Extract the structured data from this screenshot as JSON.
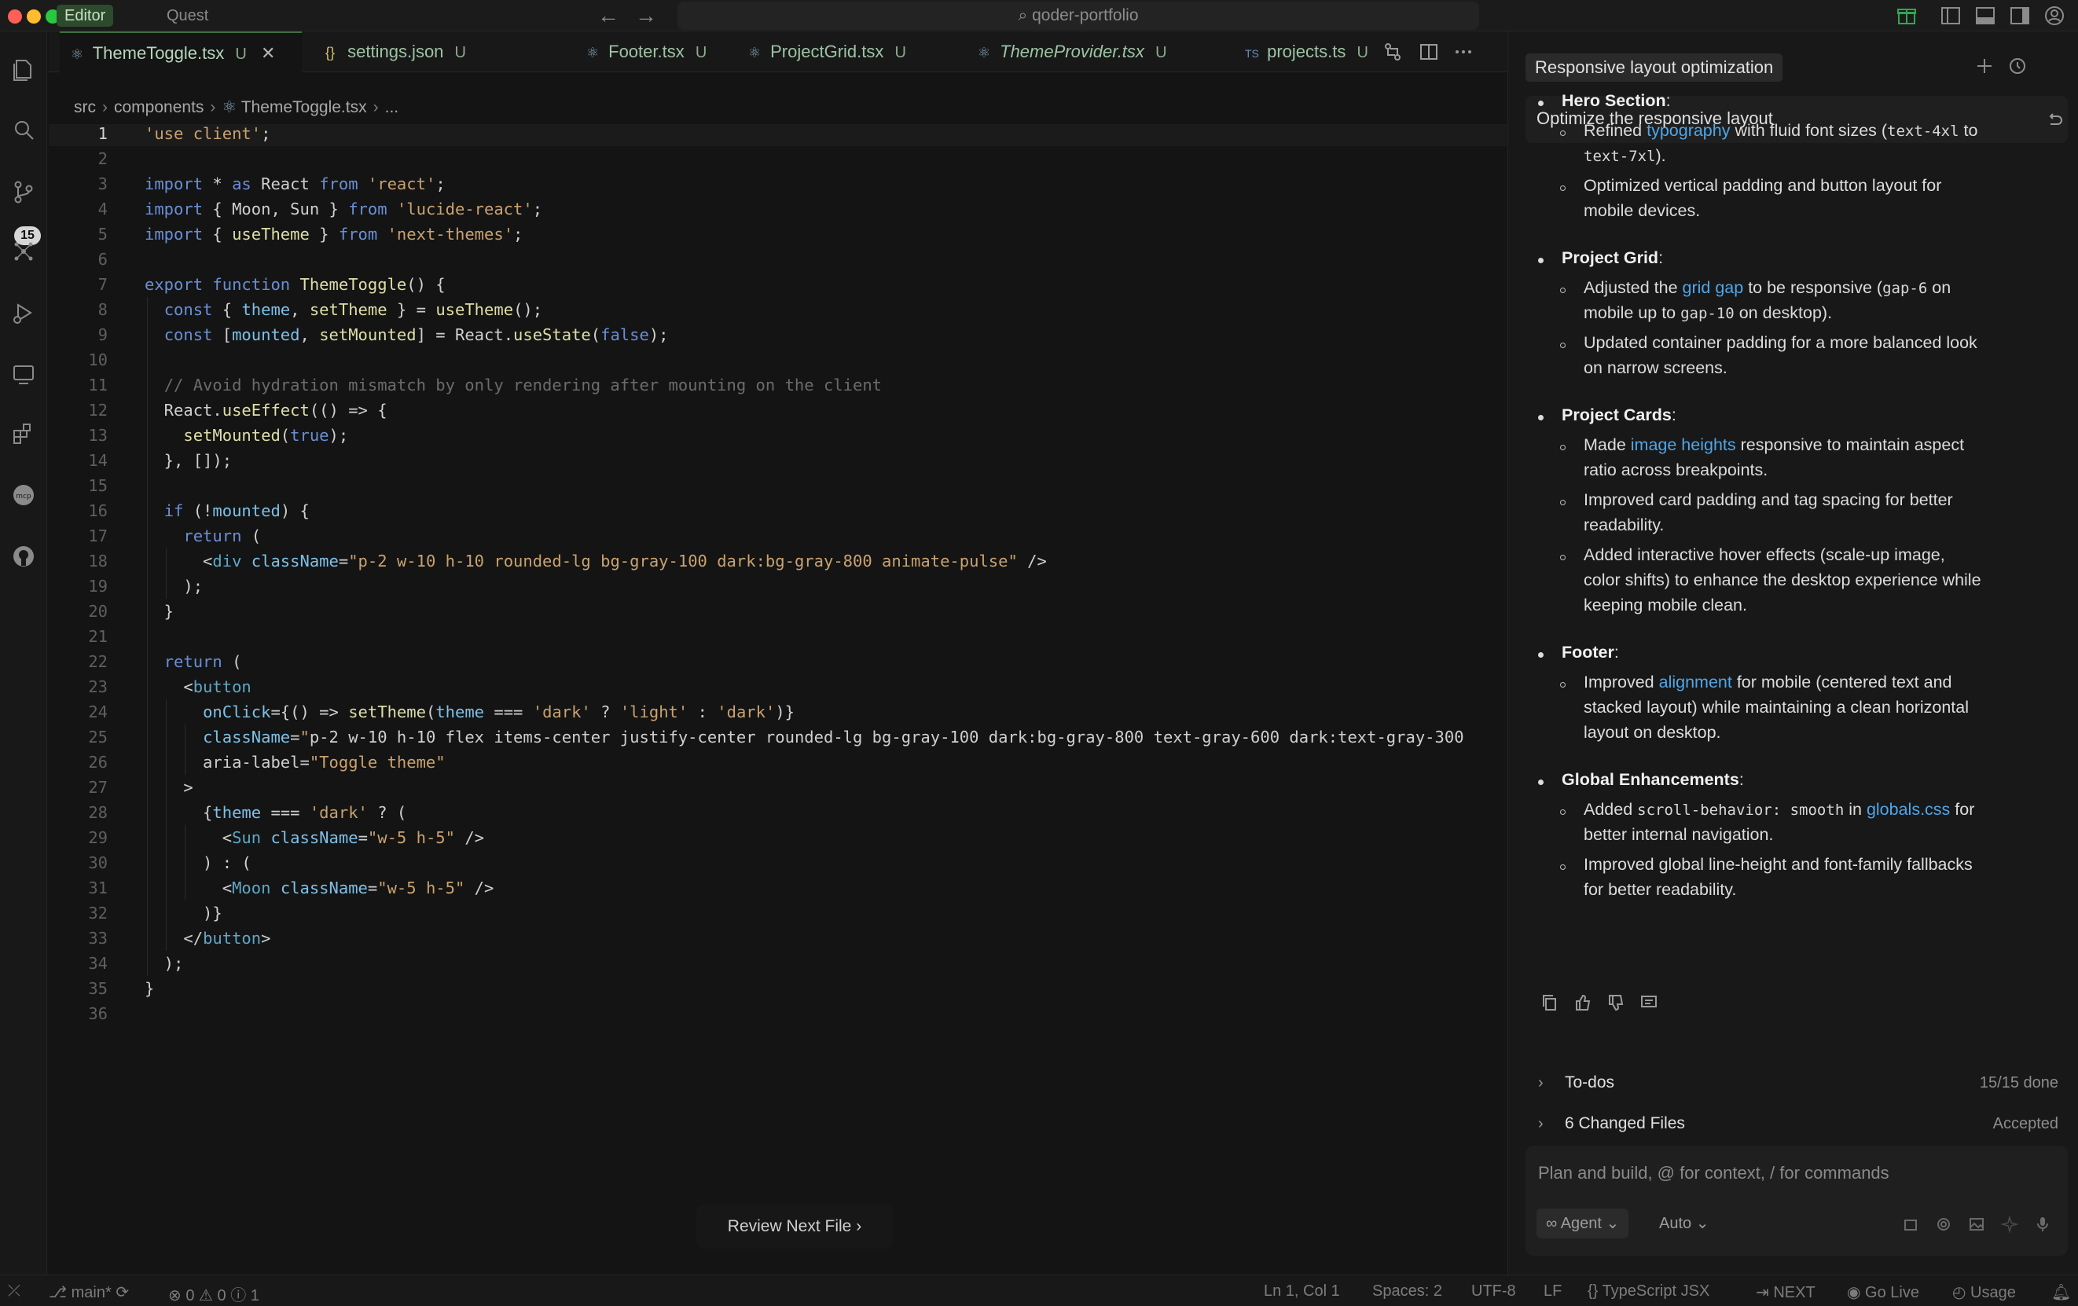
{
  "window": {
    "modes": [
      "Editor",
      "Quest"
    ],
    "search_text": "qoder-portfolio"
  },
  "activity": {
    "badge": "15"
  },
  "tabs": [
    {
      "label": "ThemeToggle.tsx",
      "status": "U",
      "icon": "react-icon",
      "active": true,
      "italic": false
    },
    {
      "label": "settings.json",
      "status": "U",
      "icon": "json-icon",
      "active": false,
      "italic": false
    },
    {
      "label": "Footer.tsx",
      "status": "U",
      "icon": "react-icon",
      "active": false,
      "italic": false
    },
    {
      "label": "ProjectGrid.tsx",
      "status": "U",
      "icon": "react-icon",
      "active": false,
      "italic": false
    },
    {
      "label": "ThemeProvider.tsx",
      "status": "U",
      "icon": "react-icon",
      "active": false,
      "italic": true
    },
    {
      "label": "projects.ts",
      "status": "U",
      "icon": "ts-icon",
      "active": false,
      "italic": false
    }
  ],
  "breadcrumb": [
    "src",
    "components",
    "ThemeToggle.tsx",
    "..."
  ],
  "editor": {
    "current_line": 1,
    "lines": [
      "'use client';",
      "",
      "import * as React from 'react';",
      "import { Moon, Sun } from 'lucide-react';",
      "import { useTheme } from 'next-themes';",
      "",
      "export function ThemeToggle() {",
      "  const { theme, setTheme } = useTheme();",
      "  const [mounted, setMounted] = React.useState(false);",
      "",
      "  // Avoid hydration mismatch by only rendering after mounting on the client",
      "  React.useEffect(() => {",
      "    setMounted(true);",
      "  }, []);",
      "",
      "  if (!mounted) {",
      "    return (",
      "      <div className=\"p-2 w-10 h-10 rounded-lg bg-gray-100 dark:bg-gray-800 animate-pulse\" />",
      "    );",
      "  }",
      "",
      "  return (",
      "    <button",
      "      onClick={() => setTheme(theme === 'dark' ? 'light' : 'dark')}",
      "      className=\"p-2 w-10 h-10 flex items-center justify-center rounded-lg bg-gray-100 dark:bg-gray-800 text-gray-600 dark:text-gray-300",
      "      aria-label=\"Toggle theme\"",
      "    >",
      "      {theme === 'dark' ? (",
      "        <Sun className=\"w-5 h-5\" />",
      "      ) : (",
      "        <Moon className=\"w-5 h-5\" />",
      "      )}",
      "    </button>",
      "  );",
      "}",
      ""
    ]
  },
  "review_button": "Review Next File",
  "panel": {
    "title": "Responsive layout optimization",
    "prompt": "Optimize the responsive layout",
    "sections": [
      {
        "heading": "Hero Section",
        "lines": [
          [
            [
              {
                "t": "Refined "
              },
              {
                "t": "typography",
                "c": "lk"
              },
              {
                "t": " with fluid font sizes ("
              },
              {
                "t": "text-4xl",
                "c": "mono"
              },
              {
                "t": " to"
              }
            ],
            [
              {
                "t": "text-7xl",
                "c": "mono"
              },
              {
                "t": ")."
              }
            ]
          ],
          [
            [
              {
                "t": "Optimized vertical padding and button layout for"
              }
            ],
            [
              {
                "t": "mobile devices."
              }
            ]
          ]
        ]
      },
      {
        "heading": "Project Grid",
        "lines": [
          [
            [
              {
                "t": "Adjusted the "
              },
              {
                "t": "grid gap",
                "c": "lk"
              },
              {
                "t": " to be responsive ("
              },
              {
                "t": "gap-6",
                "c": "mono"
              },
              {
                "t": " on"
              }
            ],
            [
              {
                "t": "mobile up to "
              },
              {
                "t": "gap-10",
                "c": "mono"
              },
              {
                "t": " on desktop)."
              }
            ]
          ],
          [
            [
              {
                "t": "Updated container padding for a more balanced look"
              }
            ],
            [
              {
                "t": "on narrow screens."
              }
            ]
          ]
        ]
      },
      {
        "heading": "Project Cards",
        "lines": [
          [
            [
              {
                "t": "Made "
              },
              {
                "t": "image heights",
                "c": "lk"
              },
              {
                "t": " responsive to maintain aspect"
              }
            ],
            [
              {
                "t": "ratio across breakpoints."
              }
            ]
          ],
          [
            [
              {
                "t": "Improved card padding and tag spacing for better"
              }
            ],
            [
              {
                "t": "readability."
              }
            ]
          ],
          [
            [
              {
                "t": "Added interactive hover effects (scale-up image,"
              }
            ],
            [
              {
                "t": "color shifts) to enhance the desktop experience while"
              }
            ],
            [
              {
                "t": "keeping mobile clean."
              }
            ]
          ]
        ]
      },
      {
        "heading": "Footer",
        "lines": [
          [
            [
              {
                "t": "Improved "
              },
              {
                "t": "alignment",
                "c": "lk"
              },
              {
                "t": " for mobile (centered text and"
              }
            ],
            [
              {
                "t": "stacked layout) while maintaining a clean horizontal"
              }
            ],
            [
              {
                "t": "layout on desktop."
              }
            ]
          ]
        ]
      },
      {
        "heading": "Global Enhancements",
        "lines": [
          [
            [
              {
                "t": "Added "
              },
              {
                "t": "scroll-behavior: smooth",
                "c": "mono"
              },
              {
                "t": " in "
              },
              {
                "t": "globals.css",
                "c": "lk"
              },
              {
                "t": " for"
              }
            ],
            [
              {
                "t": "better internal navigation."
              }
            ]
          ],
          [
            [
              {
                "t": "Improved global line-height and font-family fallbacks"
              }
            ],
            [
              {
                "t": "for better readability."
              }
            ]
          ]
        ]
      }
    ],
    "todos": {
      "label": "To-dos",
      "status": "15/15 done"
    },
    "changed": {
      "label": "6 Changed Files",
      "status": "Accepted"
    },
    "input_placeholder": "Plan and build, @ for context, / for commands",
    "agent_label": "Agent",
    "model_label": "Auto"
  },
  "statusbar": {
    "branch": "main*",
    "errors": "0",
    "warnings": "0",
    "info": "1",
    "position": "Ln 1, Col 1",
    "spaces": "Spaces: 2",
    "encoding": "UTF-8",
    "eol": "LF",
    "language": "TypeScript JSX",
    "next": "NEXT",
    "golive": "Go Live",
    "usage": "Usage"
  },
  "colors": {
    "accent": "#4fa6e8",
    "editor_bg": "#141414",
    "keyword": "#6a8fd6",
    "string": "#c9a26f"
  }
}
